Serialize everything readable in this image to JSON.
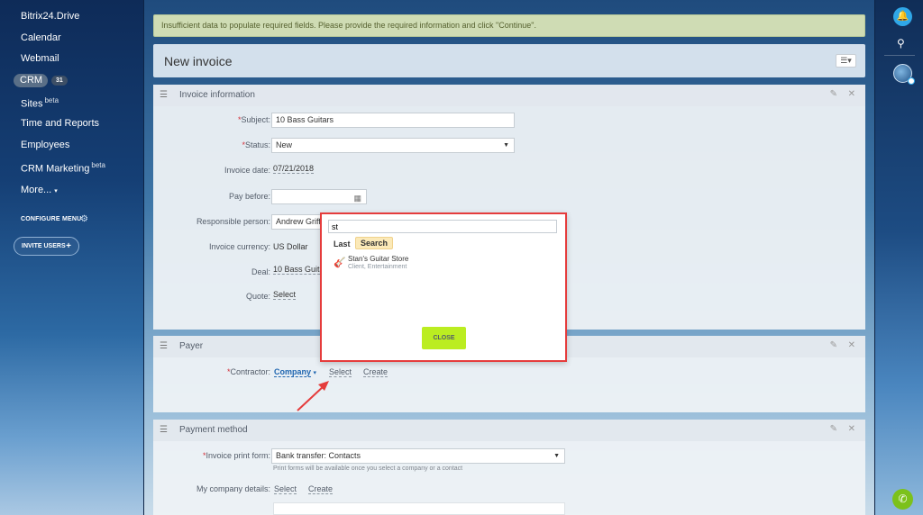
{
  "sidebar": {
    "items": [
      {
        "label": "Bitrix24.Drive"
      },
      {
        "label": "Calendar"
      },
      {
        "label": "Webmail"
      },
      {
        "label": "CRM",
        "badge": "31"
      },
      {
        "label": "Sites",
        "sup": "beta"
      },
      {
        "label": "Time and Reports"
      },
      {
        "label": "Employees"
      },
      {
        "label": "CRM Marketing",
        "sup": "beta"
      },
      {
        "label": "More...",
        "suffix": "▾"
      }
    ],
    "configure_menu": "CONFIGURE MENU",
    "invite_users": "INVITE USERS"
  },
  "alert": {
    "text": "Insufficient data to populate required fields. Please provide the required information and click \"Continue\"."
  },
  "page": {
    "title": "New invoice"
  },
  "sections": {
    "invoice_information": {
      "title": "Invoice information",
      "subject_label": "Subject:",
      "subject_value": "10 Bass Guitars",
      "status_label": "Status:",
      "status_value": "New",
      "invoice_date_label": "Invoice date:",
      "invoice_date_value": "07/21/2018",
      "pay_before_label": "Pay before:",
      "responsible_label": "Responsible person:",
      "responsible_value": "Andrew Griffi",
      "currency_label": "Invoice currency:",
      "currency_value": "US Dollar",
      "deal_label": "Deal:",
      "deal_value": "10 Bass Guita",
      "quote_label": "Quote:",
      "quote_value": "Select"
    },
    "payer": {
      "title": "Payer",
      "contractor_label": "Contractor:",
      "company_link": "Company",
      "select_link": "Select",
      "create_link": "Create"
    },
    "payment_method": {
      "title": "Payment method",
      "print_form_label": "Invoice print form:",
      "print_form_value": "Bank transfer: Contacts",
      "print_form_hint": "Print forms will be available once you select a company or a contact",
      "company_details_label": "My company details:",
      "select_link": "Select",
      "create_link": "Create"
    }
  },
  "popup": {
    "search_value": "st",
    "tab_last": "Last",
    "tab_search": "Search",
    "result_name": "Stan's Guitar Store",
    "result_sub": "Client, Entertainment",
    "close_label": "CLOSE"
  },
  "colors": {
    "accent_red": "#e53c3c",
    "close_button": "#bbed21",
    "alert_bg": "#cfdcb4",
    "link_blue": "#2066b0"
  }
}
